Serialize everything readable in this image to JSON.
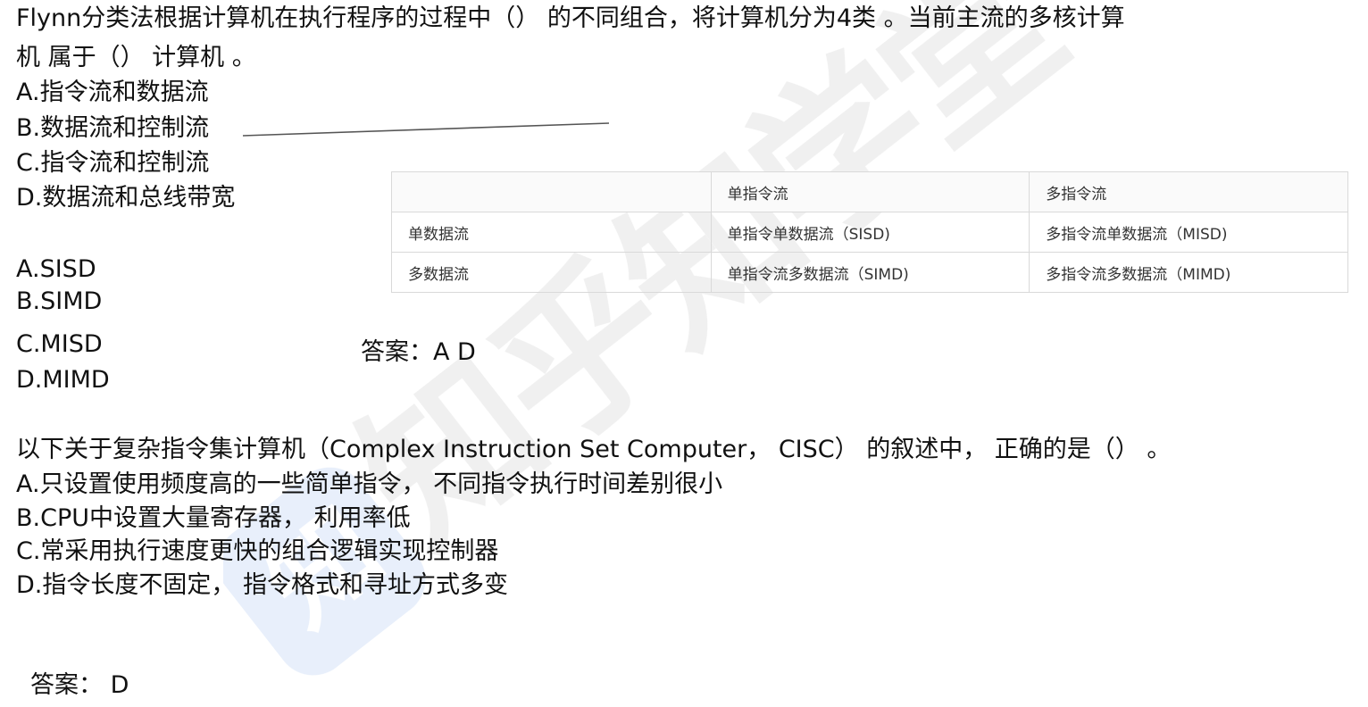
{
  "question1": {
    "stem_line1": "Flynn分类法根据计算机在执行程序的过程中（） 的不同组合，将计算机分为4类 。当前主流的多核计算",
    "stem_line2": "机 属于（） 计算机 。",
    "blank1_options": [
      "A.指令流和数据流",
      "B.数据流和控制流",
      "C.指令流和控制流",
      "D.数据流和总线带宽"
    ],
    "blank2_options": [
      "A.SISD",
      "B.SIMD",
      "C.MISD",
      "D.MIMD"
    ],
    "answer": "答案：A D"
  },
  "flynn_table": {
    "header": [
      "",
      "单指令流",
      "多指令流"
    ],
    "rows": [
      [
        "单数据流",
        "单指令单数据流（SISD)",
        "多指令流单数据流（MISD)"
      ],
      [
        "多数据流",
        "单指令流多数据流（SIMD)",
        "多指令流多数据流（MIMD)"
      ]
    ]
  },
  "question2": {
    "stem": "以下关于复杂指令集计算机（Complex Instruction Set Computer， CISC） 的叙述中， 正确的是（） 。",
    "options": [
      "A.只设置使用频度高的一些简单指令， 不同指令执行时间差别很小",
      "B.CPU中设置大量寄存器， 利用率低",
      "C.常采用执行速度更快的组合逻辑实现控制器",
      "D.指令长度不固定， 指令格式和寻址方式多变"
    ],
    "answer": "答案： D"
  },
  "watermark": {
    "brand": "知乎知学堂",
    "color": "#2f6fd6"
  }
}
